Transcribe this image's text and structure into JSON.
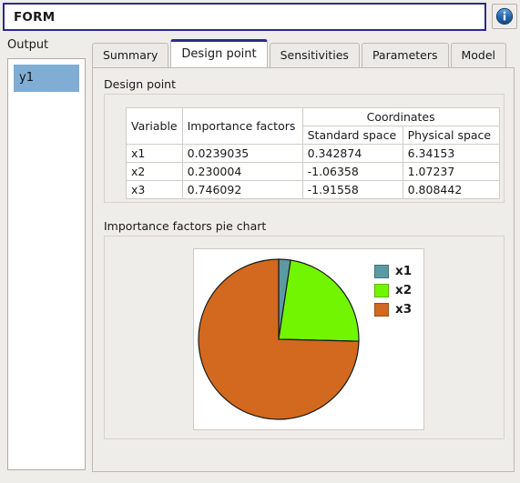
{
  "window": {
    "title": "FORM",
    "info_icon": "info-icon"
  },
  "sidebar": {
    "label": "Output",
    "items": [
      {
        "label": "y1",
        "selected": true
      }
    ]
  },
  "tabs": [
    {
      "label": "Summary",
      "active": false
    },
    {
      "label": "Design point",
      "active": true
    },
    {
      "label": "Sensitivities",
      "active": false
    },
    {
      "label": "Parameters",
      "active": false
    },
    {
      "label": "Model",
      "active": false
    }
  ],
  "design_point": {
    "group_title": "Design point",
    "table": {
      "headers": {
        "variable": "Variable",
        "importance": "Importance factors",
        "coordinates": "Coordinates",
        "standard_space": "Standard space",
        "physical_space": "Physical space"
      },
      "rows": [
        {
          "variable": "x1",
          "importance": "0.0239035",
          "standard": "0.342874",
          "physical": "6.34153"
        },
        {
          "variable": "x2",
          "importance": "0.230004",
          "standard": "-1.06358",
          "physical": "1.07237"
        },
        {
          "variable": "x3",
          "importance": "0.746092",
          "standard": "-1.91558",
          "physical": "0.808442"
        }
      ]
    }
  },
  "pie_section": {
    "group_title": "Importance factors pie chart"
  },
  "chart_data": {
    "type": "pie",
    "title": "Importance factors pie chart",
    "categories": [
      "x1",
      "x2",
      "x3"
    ],
    "values": [
      0.0239035,
      0.230004,
      0.746092
    ],
    "percentages": [
      2.39,
      23.0,
      74.61
    ],
    "colors": [
      "#5b9aa3",
      "#72f500",
      "#d2691e"
    ],
    "legend": [
      "x1",
      "x2",
      "x3"
    ],
    "legend_position": "right",
    "start_angle_deg": 0,
    "direction": "clockwise",
    "grid": false
  },
  "colors": {
    "accent": "#2b2b8f",
    "selection": "#7fadd4",
    "window_bg": "#efedea",
    "x1": "#5b9aa3",
    "x2": "#72f500",
    "x3": "#d2691e"
  }
}
